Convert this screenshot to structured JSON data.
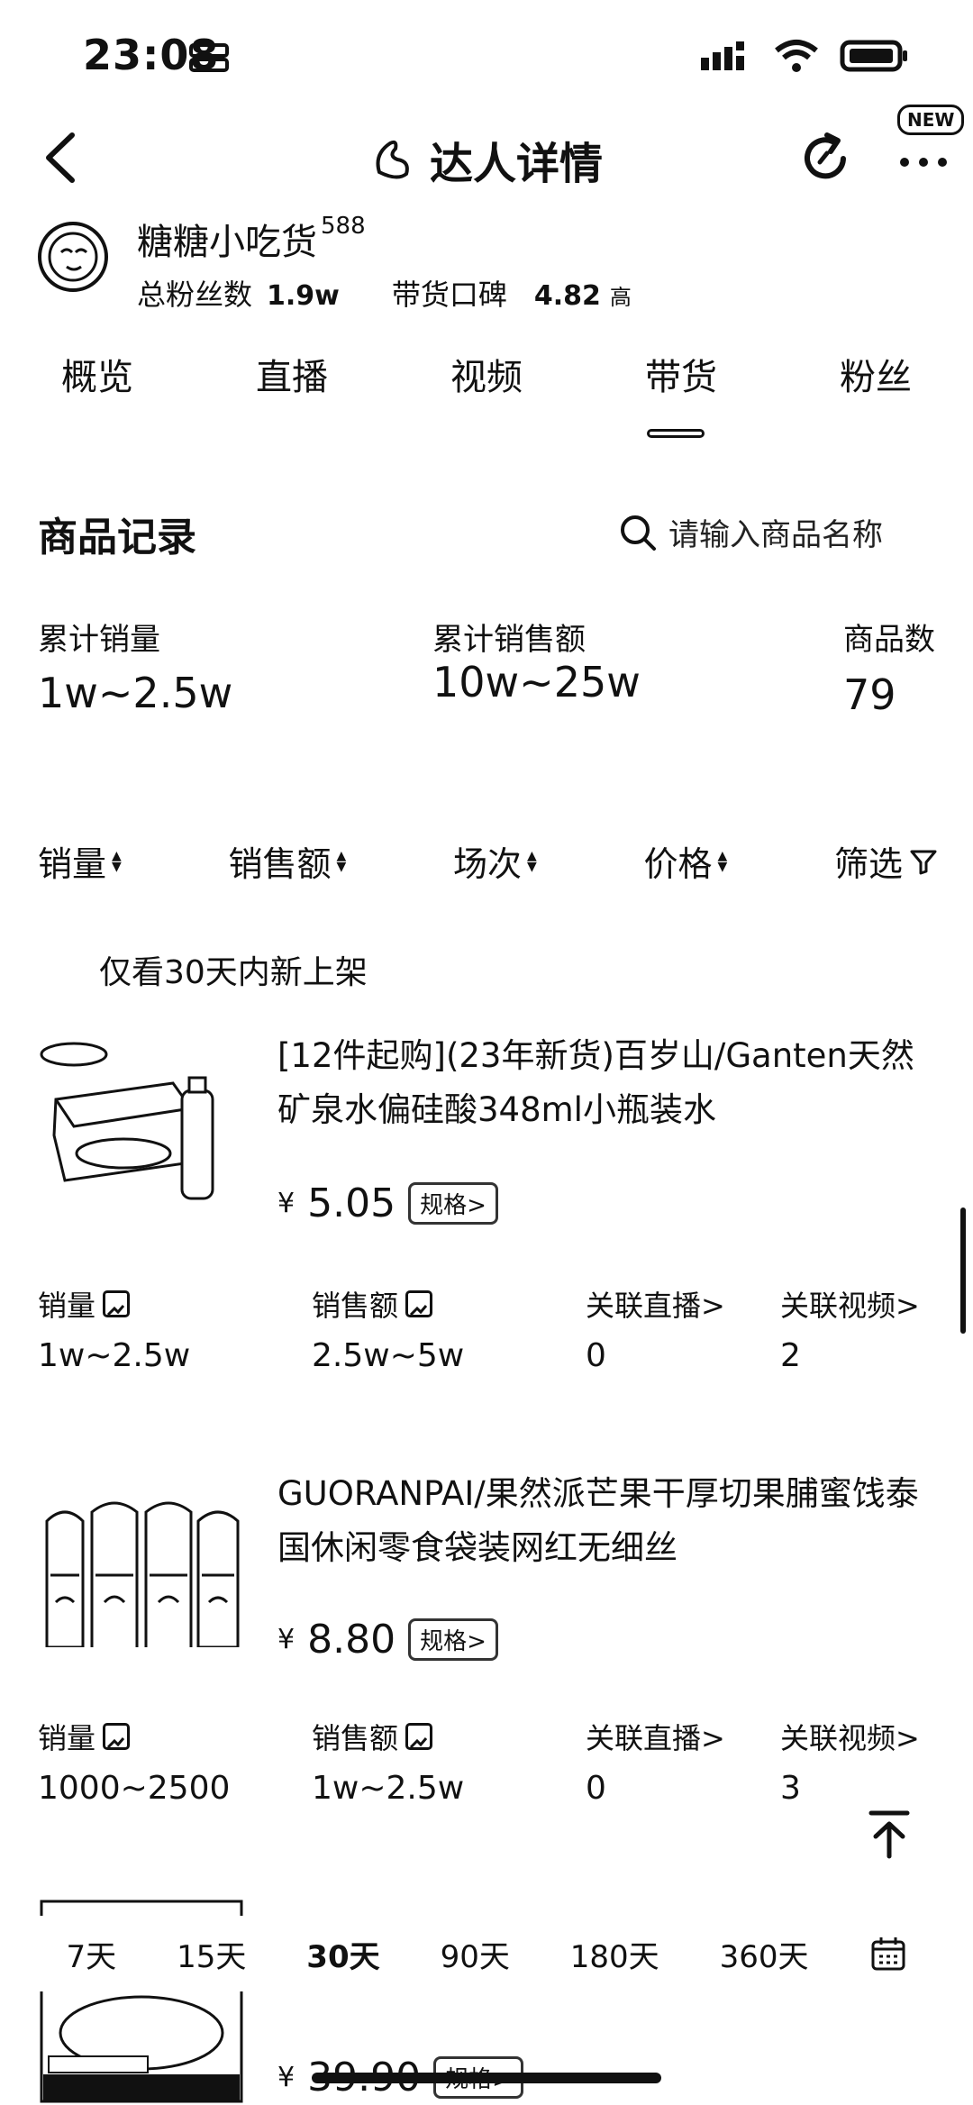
{
  "status_bar": {
    "time": "23:08"
  },
  "nav": {
    "title": "达人详情",
    "new_badge": "NEW"
  },
  "profile": {
    "name": "糖糖小吃货",
    "level": "588",
    "fans_label": "总粉丝数",
    "fans_value": "1.9w",
    "reputation_label": "带货口碑",
    "reputation_value": "4.82",
    "reputation_level": "高"
  },
  "tabs": [
    "概览",
    "直播",
    "视频",
    "带货",
    "粉丝"
  ],
  "active_tab": "带货",
  "section": {
    "title": "商品记录",
    "search_placeholder": "请输入商品名称"
  },
  "totals": [
    {
      "label": "累计销量",
      "value": "1w~2.5w"
    },
    {
      "label": "累计销售额",
      "value": "10w~25w"
    },
    {
      "label": "商品数",
      "value": "79"
    }
  ],
  "sort_bar": {
    "items": [
      "销量",
      "销售额",
      "场次",
      "价格"
    ],
    "filter": "筛选"
  },
  "new_only_label": "仅看30天内新上架",
  "products": [
    {
      "title": "[12件起购](23年新货)百岁山/Ganten天然矿泉水偏硅酸348ml小瓶装水",
      "currency": "¥",
      "price": "5.05",
      "spec_label": "规格>",
      "metrics": [
        {
          "label": "销量",
          "value": "1w~2.5w"
        },
        {
          "label": "销售额",
          "value": "2.5w~5w"
        },
        {
          "label": "关联直播>",
          "value": "0"
        },
        {
          "label": "关联视频>",
          "value": "2"
        }
      ]
    },
    {
      "title": "GUORANPAI/果然派芒果干厚切果脯蜜饯泰国休闲零食袋装网红无细丝",
      "currency": "¥",
      "price": "8.80",
      "spec_label": "规格>",
      "metrics": [
        {
          "label": "销量",
          "value": "1000~2500"
        },
        {
          "label": "销售额",
          "value": "1w~2.5w"
        },
        {
          "label": "关联直播>",
          "value": "0"
        },
        {
          "label": "关联视频>",
          "value": "3"
        }
      ]
    },
    {
      "currency": "¥",
      "price": "39.90",
      "spec_label": "规格>"
    }
  ],
  "time_range": {
    "options": [
      "7天",
      "15天",
      "30天",
      "90天",
      "180天",
      "360天"
    ],
    "active": "30天"
  }
}
